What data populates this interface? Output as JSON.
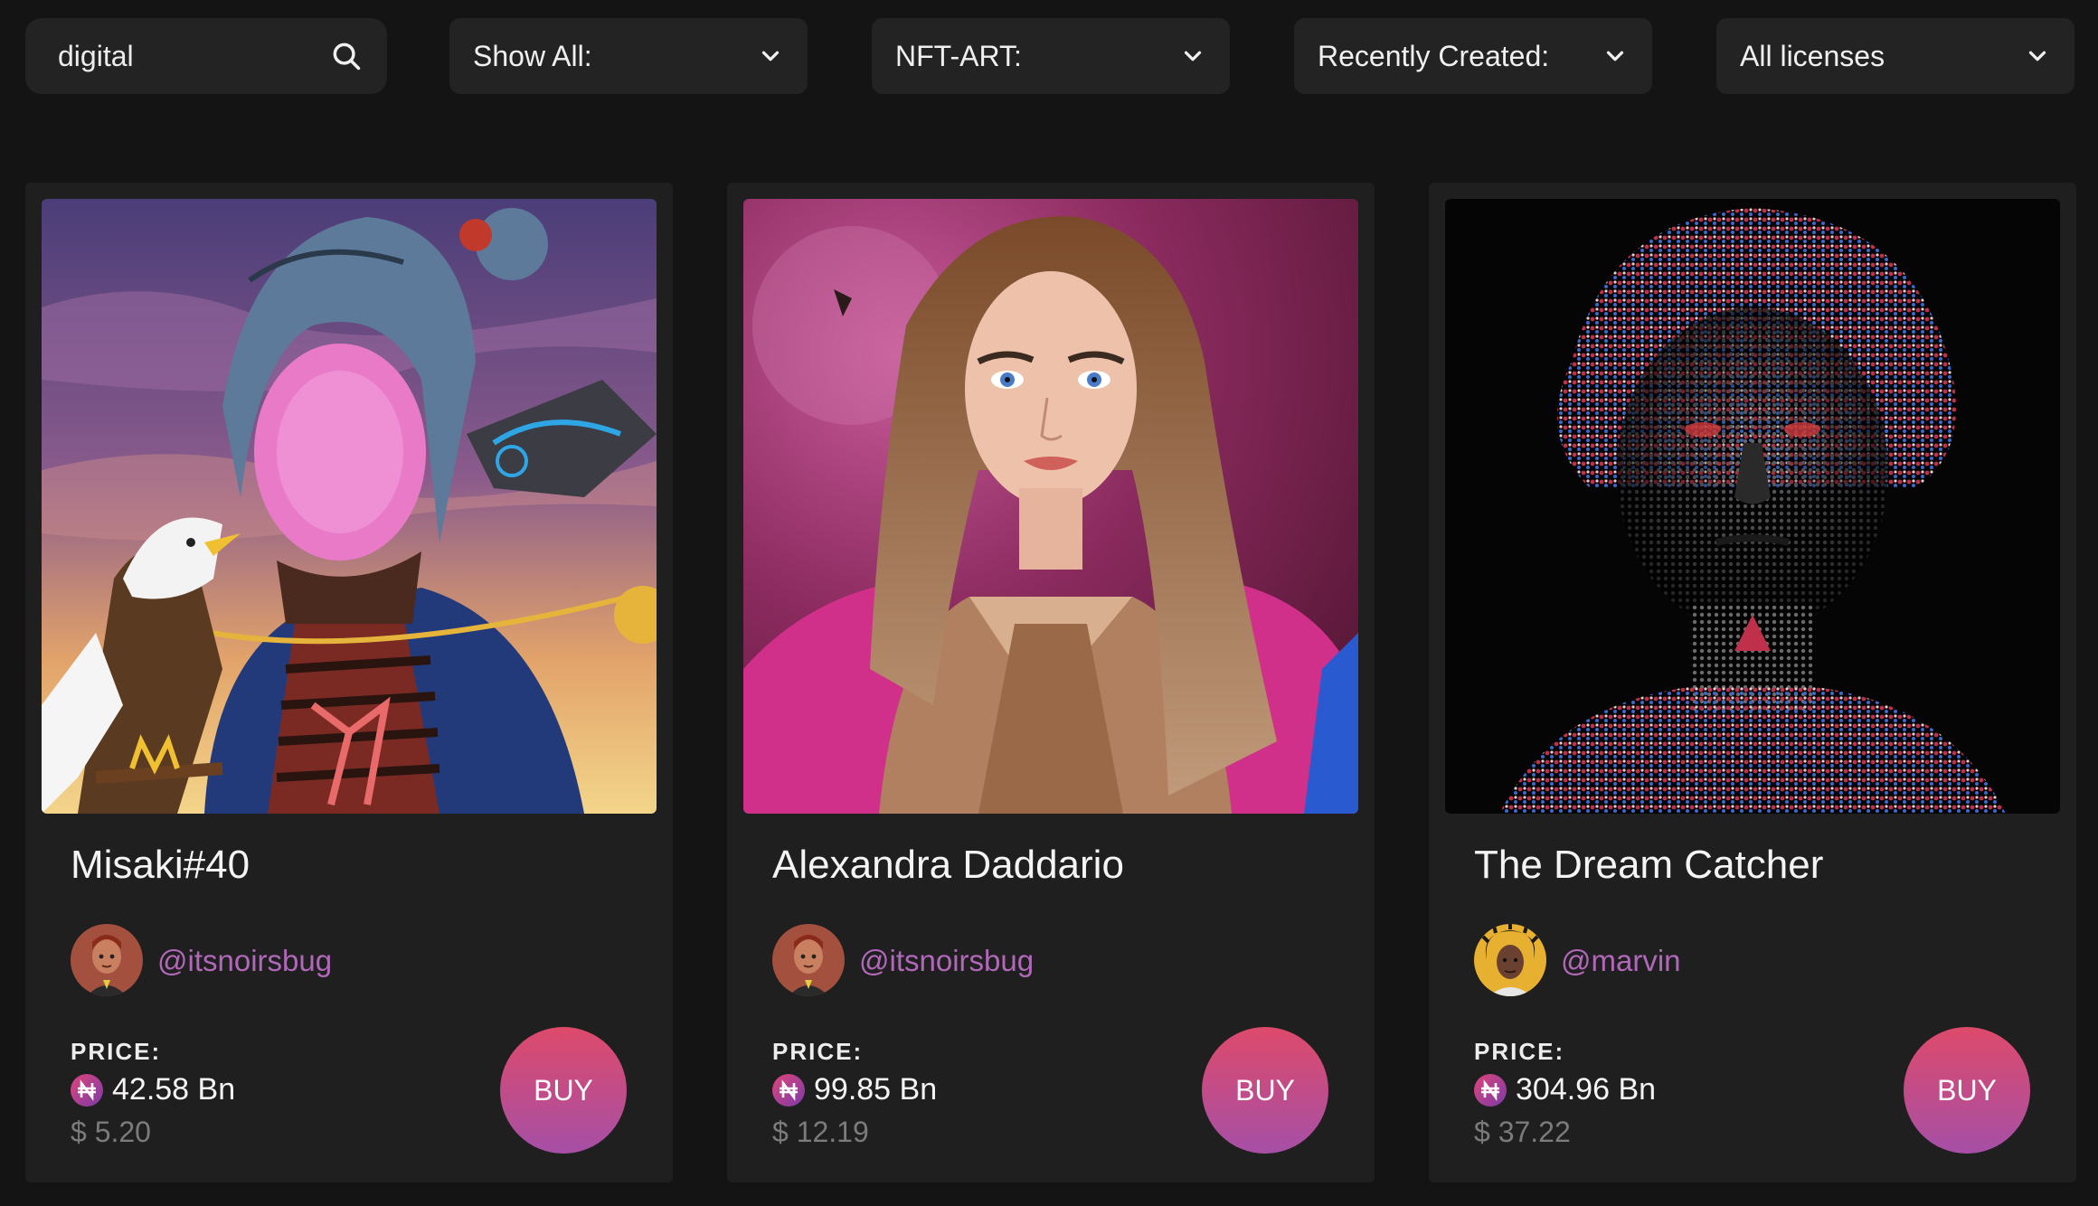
{
  "filters": {
    "search_value": "digital",
    "show_all": "Show All:",
    "category": "NFT-ART:",
    "sort": "Recently Created:",
    "license": "All licenses"
  },
  "cards": [
    {
      "title": "Misaki#40",
      "handle": "@itsnoirsbug",
      "price_label": "PRICE:",
      "price_token": "42.58 Bn",
      "price_usd": "$ 5.20",
      "buy_label": "BUY"
    },
    {
      "title": "Alexandra Daddario",
      "handle": "@itsnoirsbug",
      "price_label": "PRICE:",
      "price_token": "99.85 Bn",
      "price_usd": "$ 12.19",
      "buy_label": "BUY"
    },
    {
      "title": "The Dream Catcher",
      "handle": "@marvin",
      "price_label": "PRICE:",
      "price_token": "304.96 Bn",
      "price_usd": "$ 37.22",
      "buy_label": "BUY"
    }
  ],
  "colors": {
    "background": "#141414",
    "card": "#1f1f1f",
    "handle": "#b168b9",
    "buy_gradient_top": "#de4a6b",
    "buy_gradient_bottom": "#a64fa6"
  },
  "icons": {
    "search": "search-icon",
    "dropdown": "chevron-down-icon",
    "token": "naira-coin-icon"
  }
}
